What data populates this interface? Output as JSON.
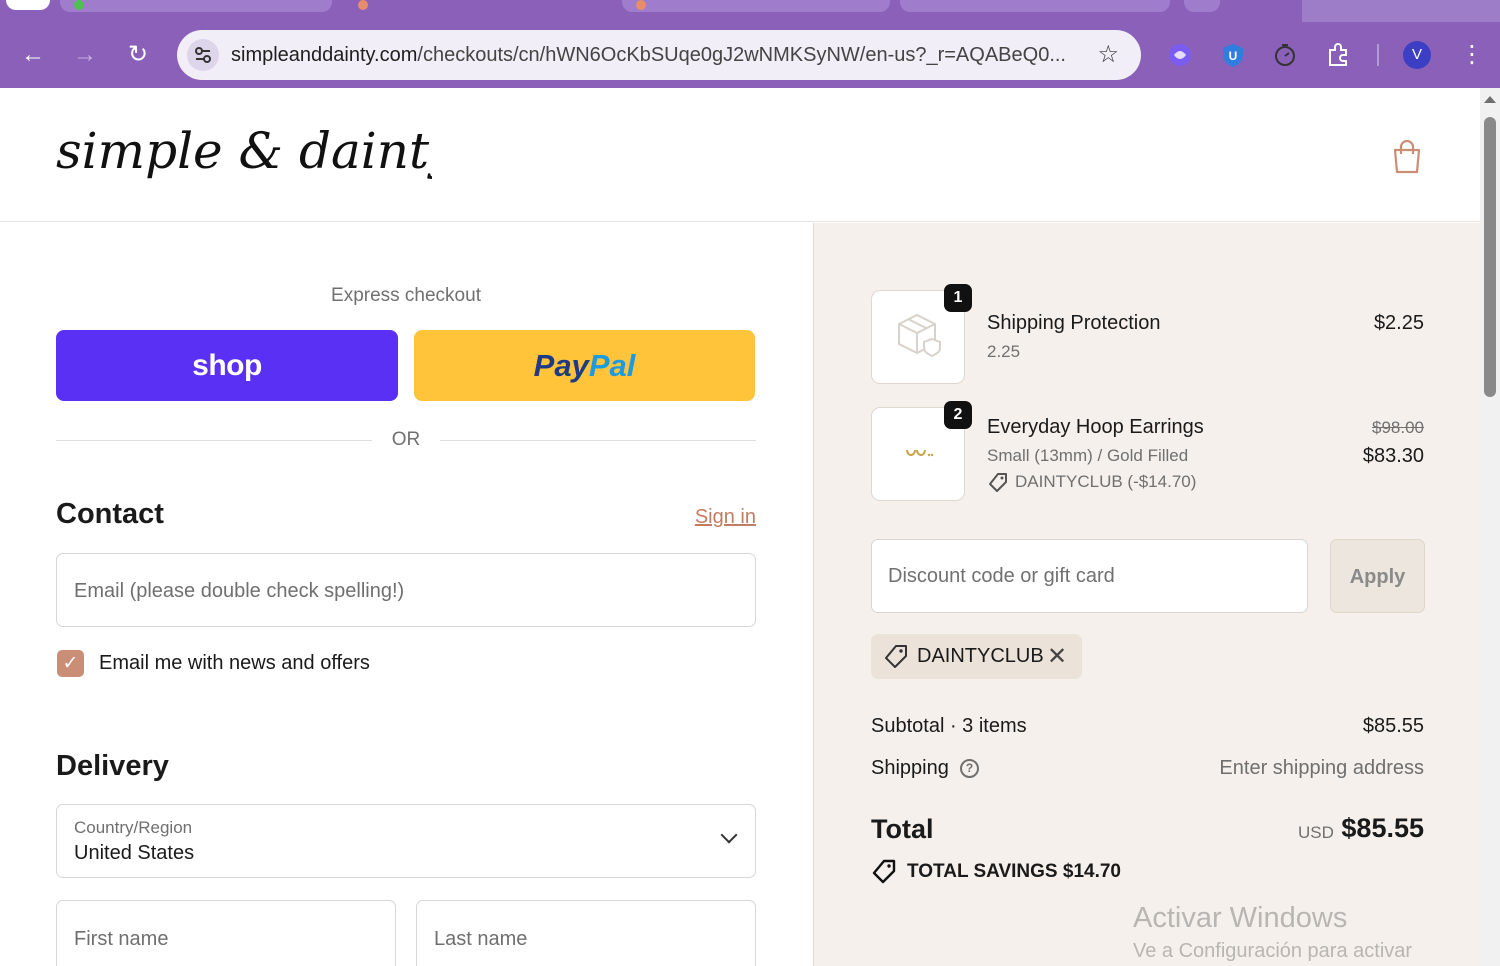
{
  "browser": {
    "url_host": "simpleanddainty.com",
    "url_path": "/checkouts/cn/hWN6OcKbSUqe0gJ2wNMKSyNW/en-us?_r=AQABeQ0...",
    "profile_initial": "V",
    "icons": [
      "back-icon",
      "forward-icon",
      "reload-icon",
      "site-settings-icon",
      "bookmark-star-icon",
      "extension-icons",
      "puzzle-extensions-icon",
      "menu-kebab-icon"
    ]
  },
  "header": {
    "logo_text": "simple & dainty",
    "cart_icon": "shopping-bag-icon"
  },
  "checkout": {
    "express_label": "Express checkout",
    "shop_label": "shop",
    "paypal_label_1": "Pay",
    "paypal_label_2": "Pal",
    "or_label": "OR",
    "contact_heading": "Contact",
    "signin_label": "Sign in",
    "email_placeholder": "Email (please double check spelling!)",
    "newsletter_label": "Email me with news and offers",
    "newsletter_checked": true,
    "delivery_heading": "Delivery",
    "country_label": "Country/Region",
    "country_value": "United States",
    "first_name_placeholder": "First name",
    "last_name_placeholder": "Last name"
  },
  "summary": {
    "items": [
      {
        "qty": "1",
        "name": "Shipping Protection",
        "sub": "2.25",
        "price": "$2.25"
      },
      {
        "qty": "2",
        "name": "Everyday Hoop Earrings",
        "sub": "Small (13mm) / Gold Filled",
        "discount": "DAINTYCLUB (-$14.70)",
        "price_old": "$98.00",
        "price": "$83.30"
      }
    ],
    "discount_placeholder": "Discount code or gift card",
    "apply_label": "Apply",
    "applied_code": "DAINTYCLUB",
    "subtotal_label": "Subtotal · 3 items",
    "subtotal_value": "$85.55",
    "shipping_label": "Shipping",
    "shipping_value": "Enter shipping address",
    "total_label": "Total",
    "total_currency": "USD",
    "total_value": "$85.55",
    "savings_label": "TOTAL SAVINGS  $14.70"
  },
  "watermark": {
    "line1": "Activar Windows",
    "line2": "Ve a Configuración para activar"
  },
  "colors": {
    "browser_purple": "#8a60b9",
    "shop_purple": "#5a31f4",
    "paypal_yellow": "#ffc43a",
    "accent": "#c17c63",
    "summary_bg": "#f5f0eb"
  }
}
